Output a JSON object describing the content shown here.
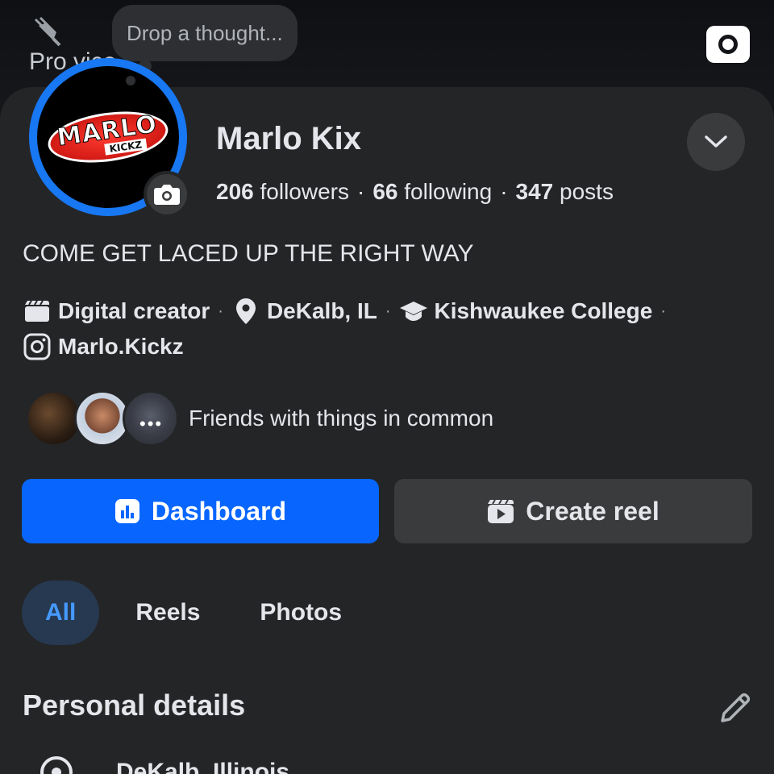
{
  "cover": {
    "partial_text": "Pro    vice"
  },
  "thought_bubble": {
    "placeholder": "Drop a thought..."
  },
  "avatar": {
    "logo_main": "MARLO",
    "logo_sub": "KICKZ"
  },
  "profile": {
    "name": "Marlo Kix",
    "followers_count": "206",
    "followers_label": "followers",
    "following_count": "66",
    "following_label": "following",
    "posts_count": "347",
    "posts_label": "posts",
    "bio": "COME GET LACED UP THE RIGHT WAY"
  },
  "info": {
    "category": "Digital creator",
    "location": "DeKalb, IL",
    "school": "Kishwaukee College",
    "instagram": "Marlo.Kickz"
  },
  "friends": {
    "text": "Friends with things in common"
  },
  "actions": {
    "dashboard": "Dashboard",
    "create_reel": "Create reel"
  },
  "tabs": [
    {
      "label": "All",
      "active": true
    },
    {
      "label": "Reels",
      "active": false
    },
    {
      "label": "Photos",
      "active": false
    }
  ],
  "personal_details": {
    "title": "Personal details",
    "first_item": "DeKalb, Illinois"
  },
  "colors": {
    "primary": "#0866ff",
    "ring": "#1877f2",
    "tab_active_bg": "#263951",
    "tab_active_text": "#4599ff",
    "card_bg": "#242527"
  }
}
